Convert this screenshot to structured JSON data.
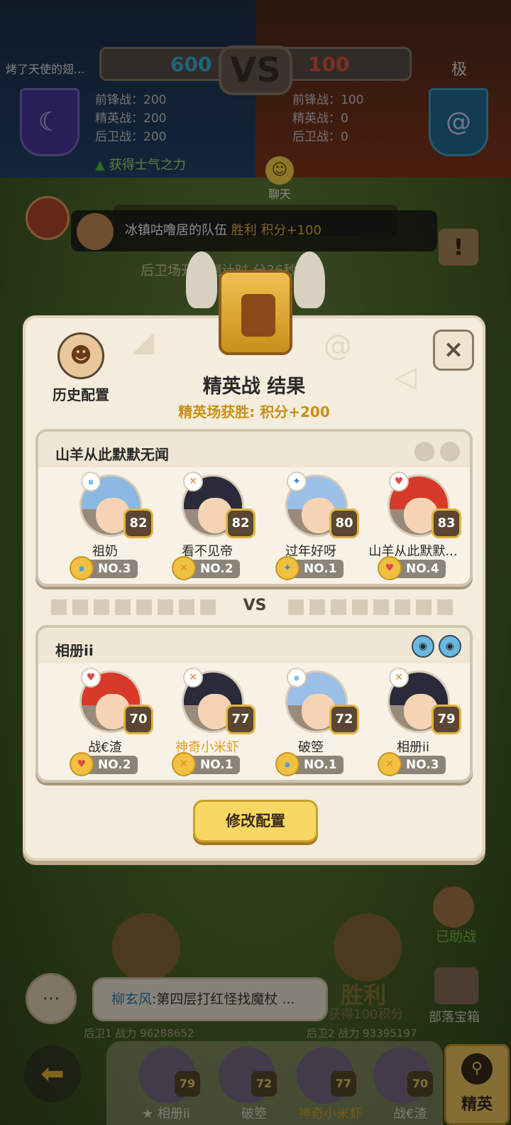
{
  "header": {
    "player_left": "烤了天使的翅...",
    "player_right": "极",
    "score_left": "600",
    "score_right": "100",
    "vs": "VS",
    "stats_left": [
      "前锋战：200",
      "精英战：200",
      "后卫战：200"
    ],
    "stats_right": [
      "前锋战：100",
      "精英战：0",
      "后卫战：0"
    ],
    "morale": "获得士气之力",
    "chat_label": "聊天"
  },
  "notice": {
    "team": "冰镇咕噜居的队伍",
    "result": "胜利 积分+100",
    "phase": "后卫场开始倒计时 分36秒"
  },
  "modal": {
    "history_label": "历史配置",
    "close_label": "×",
    "title": "精英战 结果",
    "subtitle": "精英场获胜: 积分+200",
    "vs_label": "VS",
    "modify_label": "修改配置",
    "team_top": {
      "name": "山羊从此默默无闻",
      "heroes": [
        {
          "name": "祖奶",
          "level": "82",
          "rank": "NO.3",
          "element": "wind",
          "elem_color": "#4aa0e0",
          "hair": "#8ab8e0"
        },
        {
          "name": "看不见帝",
          "level": "82",
          "rank": "NO.2",
          "element": "fire",
          "elem_color": "#e08a30",
          "hair": "#2a2a3a"
        },
        {
          "name": "过年好呀",
          "level": "80",
          "rank": "NO.1",
          "element": "ice",
          "elem_color": "#3a8ad0",
          "hair": "#9ac0e8"
        },
        {
          "name": "山羊从此默默...",
          "level": "83",
          "rank": "NO.4",
          "element": "heart",
          "elem_color": "#e04a4a",
          "hair": "#d83a2a"
        }
      ]
    },
    "team_bottom": {
      "name": "相册ii",
      "heroes": [
        {
          "name": "战€渣",
          "level": "70",
          "rank": "NO.2",
          "element": "heart",
          "elem_color": "#e04a4a",
          "hair": "#d83a2a",
          "highlight": false
        },
        {
          "name": "神奇小米虾",
          "level": "77",
          "rank": "NO.1",
          "element": "fire",
          "elem_color": "#e08a30",
          "hair": "#2a2a3a",
          "highlight": true
        },
        {
          "name": "破箜",
          "level": "72",
          "rank": "NO.1",
          "element": "wind",
          "elem_color": "#4aa0e0",
          "hair": "#9ac0e8",
          "highlight": false
        },
        {
          "name": "相册ii",
          "level": "79",
          "rank": "NO.3",
          "element": "fire",
          "elem_color": "#e08a30",
          "hair": "#2a2a3a",
          "highlight": false
        }
      ]
    }
  },
  "bottom": {
    "helper": "已助战",
    "world_chat_name": "柳玄风",
    "world_chat_text": ":第四层打红怪找魔杖 ...",
    "victory": "胜利",
    "victory_sub": "获得100积分",
    "chest_label": "部落宝箱",
    "power_left": "后卫1 战力 96288652",
    "power_right": "后卫2 战力 93395197",
    "elite_label": "精英",
    "tray": [
      {
        "name": "相册ii",
        "level": "79"
      },
      {
        "name": "破箜",
        "level": "72"
      },
      {
        "name": "神奇小米虾",
        "level": "77"
      },
      {
        "name": "战€渣",
        "level": "70"
      }
    ]
  }
}
